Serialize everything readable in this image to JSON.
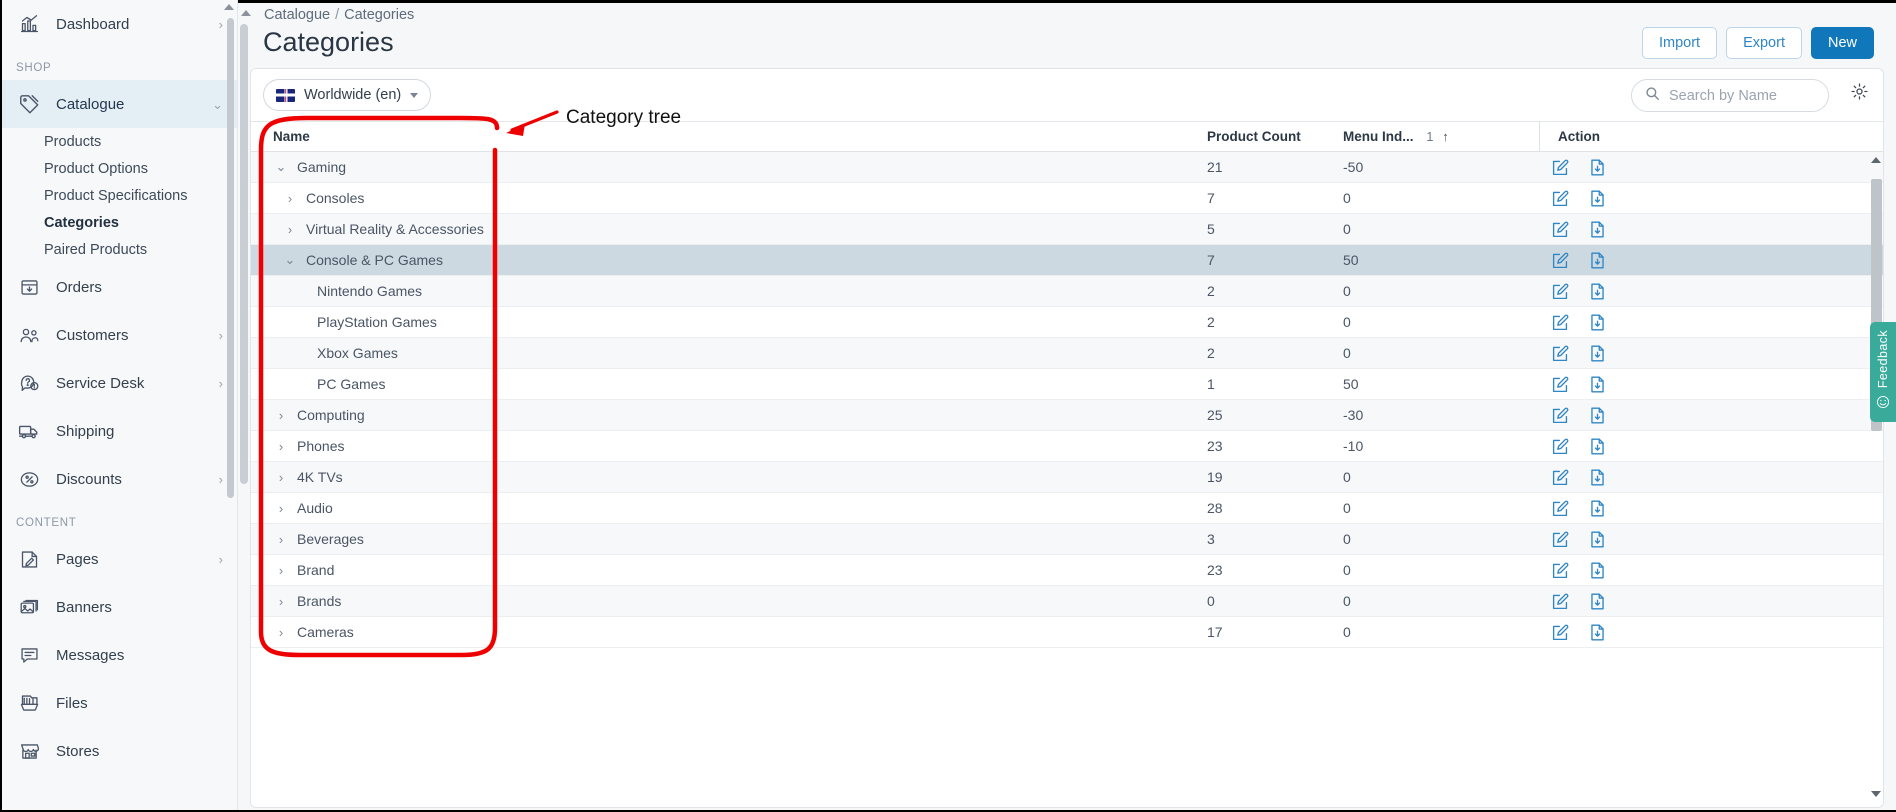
{
  "sidebar": {
    "top_items": [
      {
        "label": "Dashboard",
        "icon": "chart-bars-icon",
        "chevron": "›"
      }
    ],
    "sections": [
      {
        "title": "SHOP",
        "items": [
          {
            "label": "Catalogue",
            "icon": "tag-icon",
            "chevron": "⌄",
            "active": true,
            "children": [
              {
                "label": "Products",
                "current": false
              },
              {
                "label": "Product Options",
                "current": false
              },
              {
                "label": "Product Specifications",
                "current": false
              },
              {
                "label": "Categories",
                "current": true
              },
              {
                "label": "Paired Products",
                "current": false
              }
            ]
          },
          {
            "label": "Orders",
            "icon": "box-download-icon",
            "chevron": ""
          },
          {
            "label": "Customers",
            "icon": "users-icon",
            "chevron": "›"
          },
          {
            "label": "Service Desk",
            "icon": "question-bubble-icon",
            "chevron": "›"
          },
          {
            "label": "Shipping",
            "icon": "truck-icon",
            "chevron": ""
          },
          {
            "label": "Discounts",
            "icon": "percent-tag-icon",
            "chevron": "›"
          }
        ]
      },
      {
        "title": "CONTENT",
        "items": [
          {
            "label": "Pages",
            "icon": "page-edit-icon",
            "chevron": "›"
          },
          {
            "label": "Banners",
            "icon": "images-icon",
            "chevron": ""
          },
          {
            "label": "Messages",
            "icon": "message-icon",
            "chevron": ""
          },
          {
            "label": "Files",
            "icon": "files-icon",
            "chevron": ""
          },
          {
            "label": "Stores",
            "icon": "store-icon",
            "chevron": ""
          }
        ]
      }
    ]
  },
  "breadcrumb": {
    "parent": "Catalogue",
    "separator": "/",
    "current": "Categories"
  },
  "header": {
    "title": "Categories",
    "buttons": [
      {
        "label": "Import",
        "style": "outline"
      },
      {
        "label": "Export",
        "style": "outline"
      },
      {
        "label": "New",
        "style": "primary"
      }
    ]
  },
  "toolbar": {
    "locale": {
      "label": "Worldwide (en)",
      "flag": "uk-flag-icon"
    },
    "search": {
      "placeholder": "Search by Name",
      "value": ""
    },
    "settings_icon": "gear-icon"
  },
  "table": {
    "columns": [
      {
        "key": "name",
        "label": "Name"
      },
      {
        "key": "count",
        "label": "Product Count"
      },
      {
        "key": "index",
        "label": "Menu Ind...",
        "sort_order": "1",
        "sort_dir": "↑"
      },
      {
        "key": "action",
        "label": "Action"
      }
    ],
    "row_actions": [
      {
        "name": "edit-icon",
        "title": "Edit"
      },
      {
        "name": "download-icon",
        "title": "Download"
      }
    ],
    "rows": [
      {
        "name": "Gaming",
        "level": 0,
        "twisty": "expanded",
        "count": "21",
        "index": "-50",
        "selected": false
      },
      {
        "name": "Consoles",
        "level": 1,
        "twisty": "collapsed",
        "count": "7",
        "index": "0",
        "selected": false
      },
      {
        "name": "Virtual Reality & Accessories",
        "level": 1,
        "twisty": "collapsed",
        "count": "5",
        "index": "0",
        "selected": false
      },
      {
        "name": "Console & PC Games",
        "level": 1,
        "twisty": "expanded",
        "count": "7",
        "index": "50",
        "selected": true
      },
      {
        "name": "Nintendo Games",
        "level": 2,
        "twisty": "none",
        "count": "2",
        "index": "0",
        "selected": false
      },
      {
        "name": "PlayStation Games",
        "level": 2,
        "twisty": "none",
        "count": "2",
        "index": "0",
        "selected": false
      },
      {
        "name": "Xbox Games",
        "level": 2,
        "twisty": "none",
        "count": "2",
        "index": "0",
        "selected": false
      },
      {
        "name": "PC Games",
        "level": 2,
        "twisty": "none",
        "count": "1",
        "index": "50",
        "selected": false
      },
      {
        "name": "Computing",
        "level": 0,
        "twisty": "collapsed",
        "count": "25",
        "index": "-30",
        "selected": false
      },
      {
        "name": "Phones",
        "level": 0,
        "twisty": "collapsed",
        "count": "23",
        "index": "-10",
        "selected": false
      },
      {
        "name": "4K TVs",
        "level": 0,
        "twisty": "collapsed",
        "count": "19",
        "index": "0",
        "selected": false
      },
      {
        "name": "Audio",
        "level": 0,
        "twisty": "collapsed",
        "count": "28",
        "index": "0",
        "selected": false
      },
      {
        "name": "Beverages",
        "level": 0,
        "twisty": "collapsed",
        "count": "3",
        "index": "0",
        "selected": false
      },
      {
        "name": "Brand",
        "level": 0,
        "twisty": "collapsed",
        "count": "23",
        "index": "0",
        "selected": false
      },
      {
        "name": "Brands",
        "level": 0,
        "twisty": "collapsed",
        "count": "0",
        "index": "0",
        "selected": false
      },
      {
        "name": "Cameras",
        "level": 0,
        "twisty": "collapsed",
        "count": "17",
        "index": "0",
        "selected": false
      }
    ]
  },
  "annotation": {
    "label": "Category tree",
    "color": "#ee0000"
  },
  "feedback": {
    "label": "Feedback",
    "icon": "smiley-icon",
    "color": "#3aab9b"
  },
  "colors": {
    "accent": "#1177bb",
    "link": "#2f86c6",
    "selected_row": "#cdd9e1",
    "sidebar_active": "#e4eef5"
  }
}
